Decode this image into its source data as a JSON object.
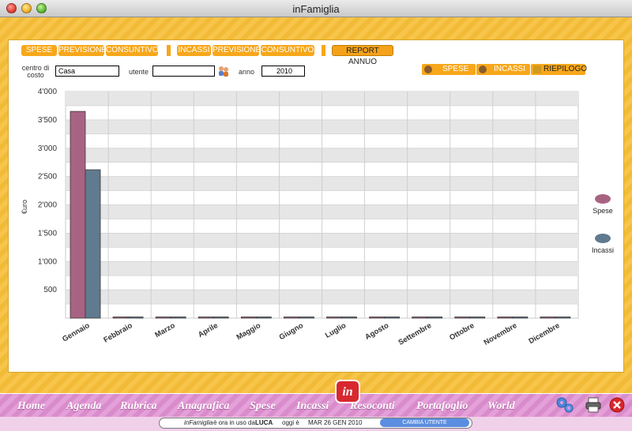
{
  "window": {
    "title": "inFamiglia"
  },
  "tabs": {
    "spese": "SPESE",
    "spese_previsione": "PREVISIONE",
    "spese_consuntivo": "CONSUNTIVO",
    "incassi": "INCASSI",
    "incassi_previsione": "PREVISIONE",
    "incassi_consuntivo": "CONSUNTIVO",
    "report_annuo": "REPORT ANNUO"
  },
  "filters": {
    "centro_label": "centro di costo",
    "centro_value": "Casa",
    "utente_label": "utente",
    "utente_value": "",
    "anno_label": "anno",
    "anno_value": "2010"
  },
  "view_buttons": {
    "spese": "SPESE",
    "incassi": "INCASSI",
    "riepilogo": "RIEPILOGO"
  },
  "chart_data": {
    "type": "bar",
    "ylabel": "€uro",
    "xlabel": "",
    "ylim": [
      0,
      4000
    ],
    "yticks": [
      "500",
      "1'000",
      "1'500",
      "2'000",
      "2'500",
      "3'000",
      "3'500",
      "4'000"
    ],
    "categories": [
      "Gennaio",
      "Febbraio",
      "Marzo",
      "Aprile",
      "Maggio",
      "Giugno",
      "Luglio",
      "Agosto",
      "Settembre",
      "Ottobre",
      "Novembre",
      "Dicembre"
    ],
    "series": [
      {
        "name": "Spese",
        "color": "#a86383",
        "values": [
          3650,
          0,
          0,
          0,
          0,
          0,
          0,
          0,
          0,
          0,
          0,
          0
        ]
      },
      {
        "name": "Incassi",
        "color": "#607a8f",
        "values": [
          2620,
          0,
          0,
          0,
          0,
          0,
          0,
          0,
          0,
          0,
          0,
          0
        ]
      }
    ],
    "grid": true,
    "legend": "right"
  },
  "nav": [
    "Home",
    "Agenda",
    "Rubrica",
    "Anagrafica",
    "Spese",
    "Incassi",
    "Resoconti",
    "Portafoglio",
    "World"
  ],
  "logo": "in",
  "status": {
    "app": "inFamiglia",
    "in_uso": " è ora in uso da ",
    "user": "LUCA",
    "oggi": "oggi è",
    "date": "MAR 26 GEN 2010",
    "cambia": "CAMBIA UTENTE"
  }
}
